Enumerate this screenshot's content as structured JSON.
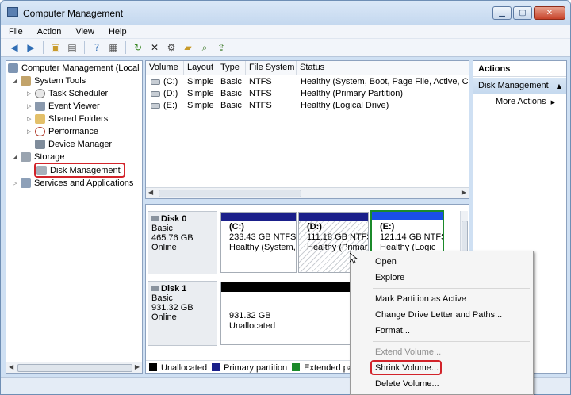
{
  "window": {
    "title": "Computer Management",
    "buttons": [
      "minimize",
      "maximize",
      "close"
    ]
  },
  "menu": [
    "File",
    "Action",
    "View",
    "Help"
  ],
  "toolbar_icons": [
    "back-arrow-icon",
    "forward-arrow-icon",
    "up-folder-icon",
    "show-hide-tree-icon",
    "help-icon",
    "properties-icon",
    "refresh-icon",
    "delete-icon",
    "settings-icon",
    "open-folder-icon",
    "search-icon",
    "export-icon"
  ],
  "tree": {
    "root": "Computer Management (Local",
    "system_tools": "System Tools",
    "task_scheduler": "Task Scheduler",
    "event_viewer": "Event Viewer",
    "shared_folders": "Shared Folders",
    "performance": "Performance",
    "device_manager": "Device Manager",
    "storage": "Storage",
    "disk_management": "Disk Management",
    "services": "Services and Applications"
  },
  "volumes": {
    "columns": [
      "Volume",
      "Layout",
      "Type",
      "File System",
      "Status"
    ],
    "rows": [
      {
        "volume": "(C:)",
        "layout": "Simple",
        "type": "Basic",
        "fs": "NTFS",
        "status": "Healthy (System, Boot, Page File, Active, Cras"
      },
      {
        "volume": "(D:)",
        "layout": "Simple",
        "type": "Basic",
        "fs": "NTFS",
        "status": "Healthy (Primary Partition)"
      },
      {
        "volume": "(E:)",
        "layout": "Simple",
        "type": "Basic",
        "fs": "NTFS",
        "status": "Healthy (Logical Drive)"
      }
    ]
  },
  "disks": {
    "disk0": {
      "name": "Disk 0",
      "type": "Basic",
      "size": "465.76 GB",
      "state": "Online",
      "parts": [
        {
          "label": "(C:)",
          "size": "233.43 GB NTFS",
          "status": "Healthy (System,"
        },
        {
          "label": "(D:)",
          "size": "111.18 GB NTFS",
          "status": "Healthy (Primar"
        },
        {
          "label": "(E:)",
          "size": "121.14 GB NTFS",
          "status": "Healthy (Logic"
        }
      ]
    },
    "disk1": {
      "name": "Disk 1",
      "type": "Basic",
      "size": "931.32 GB",
      "state": "Online",
      "unalloc_size": "931.32 GB",
      "unalloc_label": "Unallocated"
    }
  },
  "legend": [
    "Unallocated",
    "Primary partition",
    "Extended part"
  ],
  "colors": {
    "unallocated": "#000000",
    "primary": "#1a1f8a",
    "extended": "#1b8a2a",
    "logical": "#1a4fe6",
    "highlight": "#d2232a"
  },
  "actions": {
    "header": "Actions",
    "section": "Disk Management",
    "more": "More Actions"
  },
  "context_menu": {
    "open": "Open",
    "explore": "Explore",
    "mark_active": "Mark Partition as Active",
    "change_letter": "Change Drive Letter and Paths...",
    "format": "Format...",
    "extend": "Extend Volume...",
    "shrink": "Shrink Volume...",
    "delete": "Delete Volume..."
  }
}
